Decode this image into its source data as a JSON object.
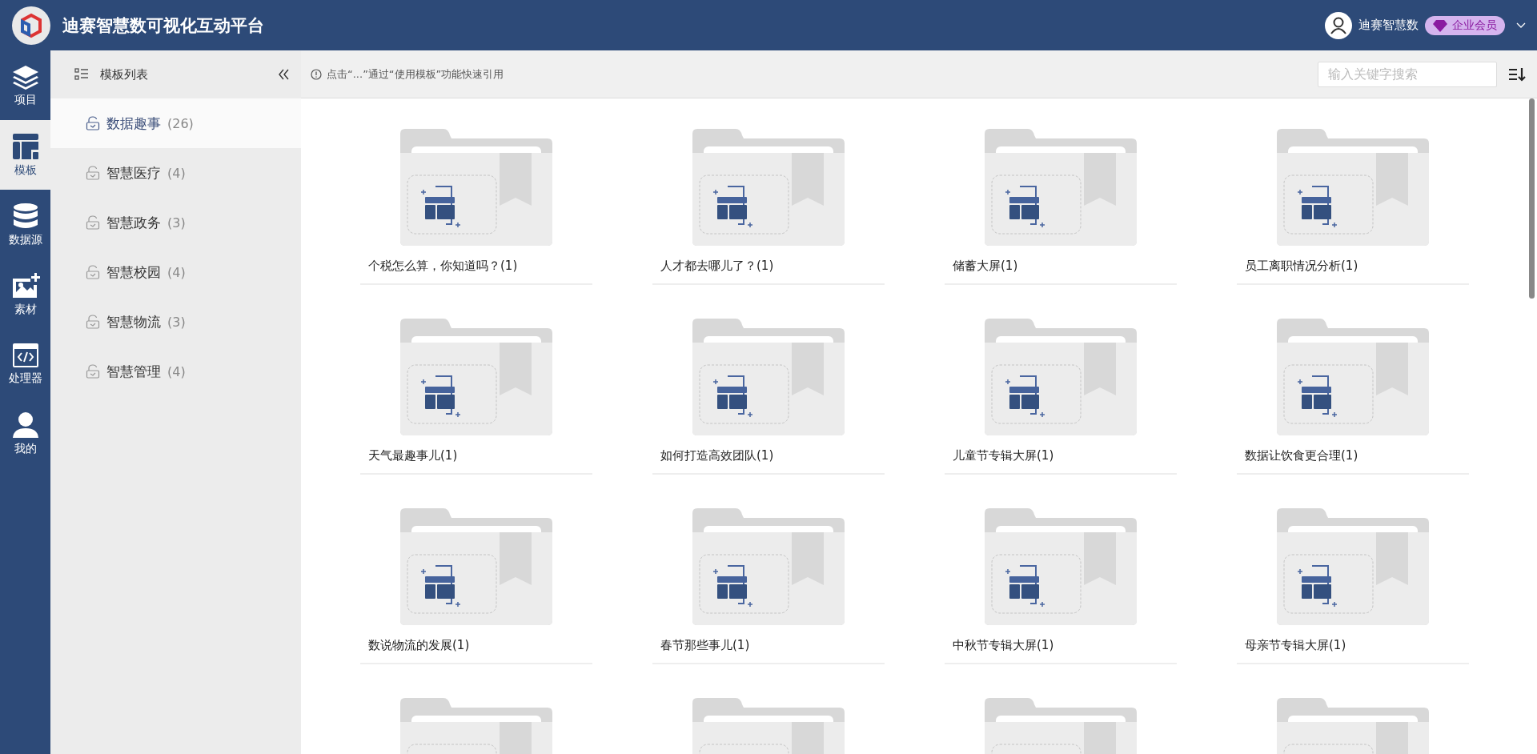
{
  "header": {
    "title": "迪赛智慧数可视化互动平台",
    "user_name": "迪赛智慧数",
    "member_badge": "企业会员"
  },
  "nav": [
    {
      "label": "项目",
      "selected": false
    },
    {
      "label": "模板",
      "selected": true
    },
    {
      "label": "数据源",
      "selected": false
    },
    {
      "label": "素材",
      "selected": false
    },
    {
      "label": "处理器",
      "selected": false
    },
    {
      "label": "我的",
      "selected": false
    }
  ],
  "sidebar": {
    "title": "模板列表",
    "categories": [
      {
        "name": "数据趣事",
        "count": "(26)",
        "selected": true
      },
      {
        "name": "智慧医疗",
        "count": "(4)",
        "selected": false
      },
      {
        "name": "智慧政务",
        "count": "(3)",
        "selected": false
      },
      {
        "name": "智慧校园",
        "count": "(4)",
        "selected": false
      },
      {
        "name": "智慧物流",
        "count": "(3)",
        "selected": false
      },
      {
        "name": "智慧管理",
        "count": "(4)",
        "selected": false
      }
    ]
  },
  "toolbar": {
    "hint": "点击“...”通过“使用模板”功能快速引用",
    "search": {
      "placeholder": "输入关键字搜索"
    }
  },
  "templates": [
    {
      "title": "个税怎么算，你知道吗？(1)"
    },
    {
      "title": "人才都去哪儿了？(1)"
    },
    {
      "title": "储蓄大屏(1)"
    },
    {
      "title": "员工离职情况分析(1)"
    },
    {
      "title": "天气最趣事儿(1)"
    },
    {
      "title": "如何打造高效团队(1)"
    },
    {
      "title": "儿童节专辑大屏(1)"
    },
    {
      "title": "数据让饮食更合理(1)"
    },
    {
      "title": "数说物流的发展(1)"
    },
    {
      "title": "春节那些事儿(1)"
    },
    {
      "title": "中秋节专辑大屏(1)"
    },
    {
      "title": "母亲节专辑大屏(1)"
    }
  ]
}
